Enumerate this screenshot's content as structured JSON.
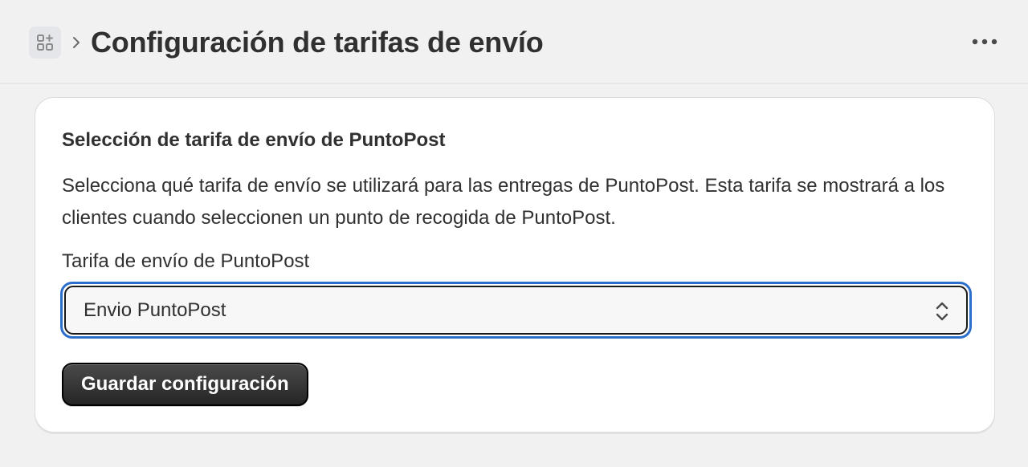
{
  "header": {
    "app_icon": "apps-plus-icon",
    "separator_icon": "chevron-right-icon",
    "title": "Configuración de tarifas de envío",
    "more_icon": "ellipsis-horizontal-icon"
  },
  "card": {
    "heading": "Selección de tarifa de envío de PuntoPost",
    "description": "Selecciona qué tarifa de envío se utilizará para las entregas de PuntoPost. Esta tarifa se mostrará a los clientes cuando seleccionen un punto de recogida de PuntoPost.",
    "field_label": "Tarifa de envío de PuntoPost",
    "select_value": "Envio PuntoPost",
    "select_icon": "select-up-down-icon",
    "save_label": "Guardar configuración"
  },
  "colors": {
    "background": "#f1f1f1",
    "card": "#ffffff",
    "focus_ring": "#2c6ecb",
    "primary_button": "#303030",
    "text": "#303030"
  }
}
